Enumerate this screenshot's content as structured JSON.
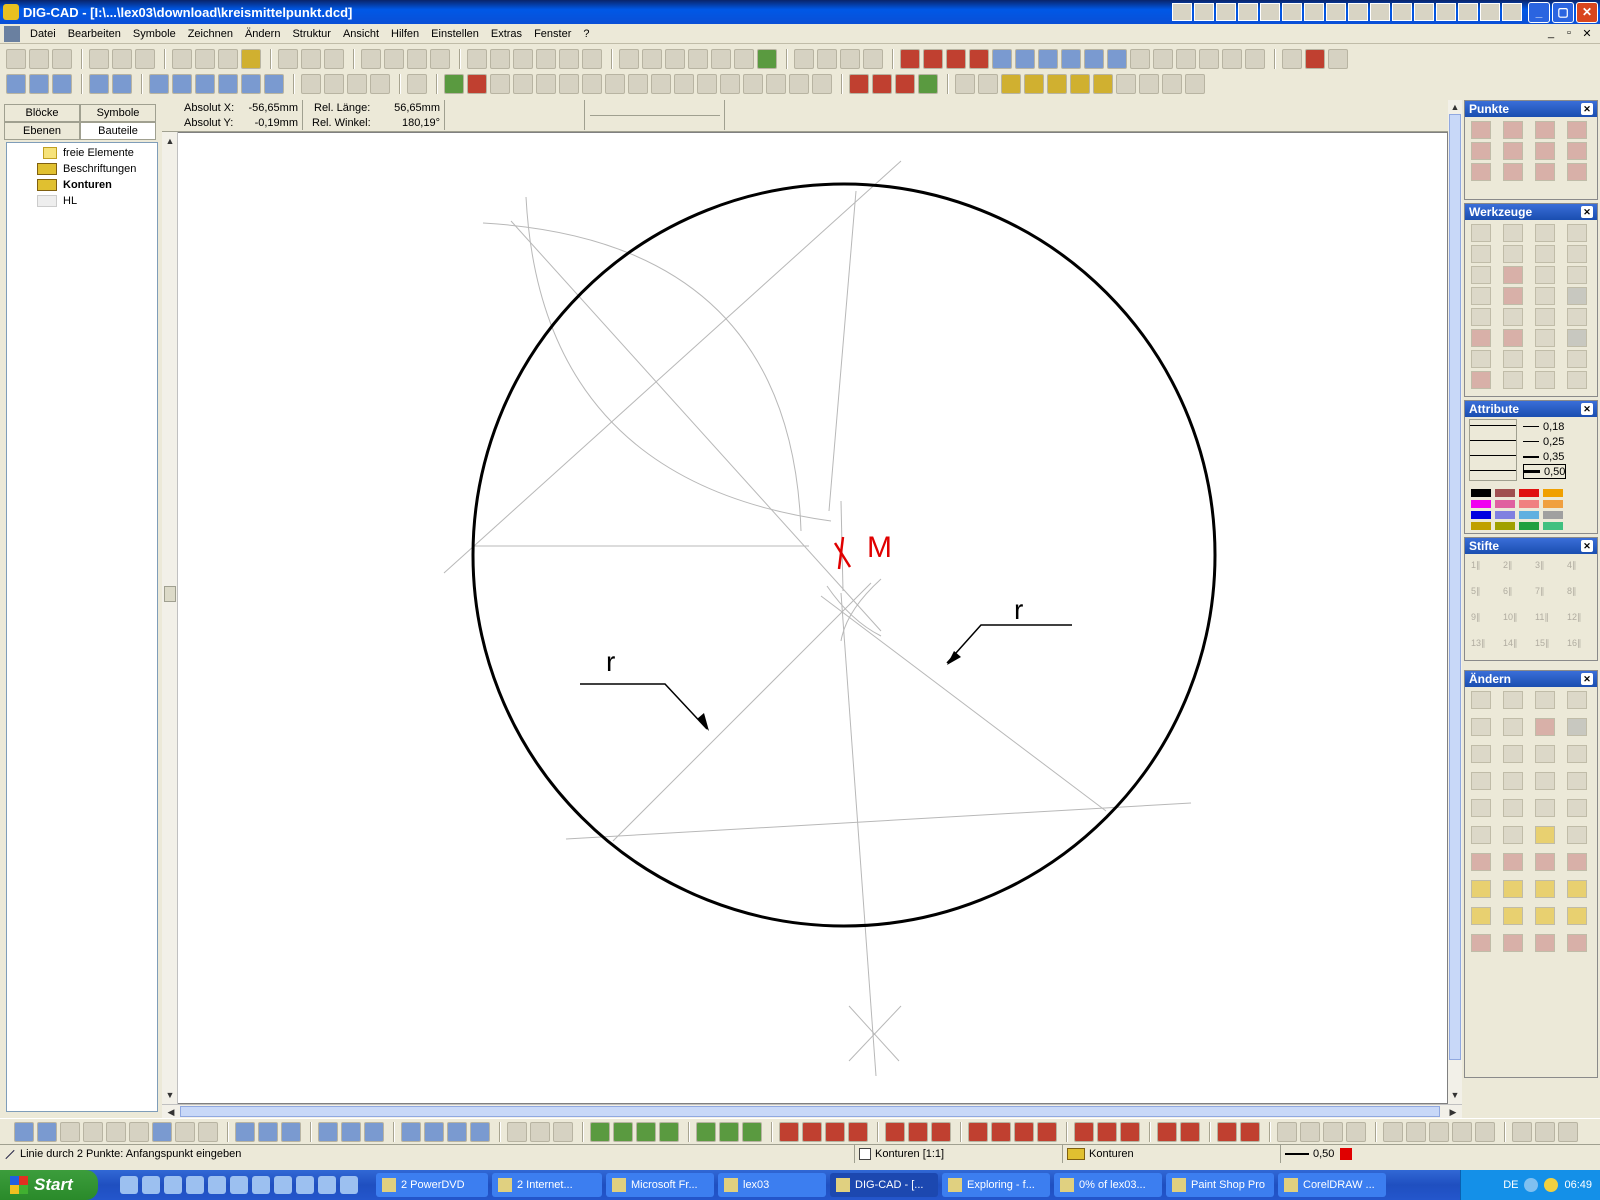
{
  "window": {
    "title": "DIG-CAD - [I:\\...\\lex03\\download\\kreismittelpunkt.dcd]"
  },
  "menu": [
    "Datei",
    "Bearbeiten",
    "Symbole",
    "Zeichnen",
    "Ändern",
    "Struktur",
    "Ansicht",
    "Hilfen",
    "Einstellen",
    "Extras",
    "Fenster",
    "?"
  ],
  "left": {
    "tabs": [
      "Blöcke",
      "Symbole",
      "Ebenen",
      "Bauteile"
    ],
    "tree": [
      "freie Elemente",
      "Beschriftungen",
      "Konturen",
      "HL"
    ]
  },
  "coords": {
    "absx_label": "Absolut X:",
    "absx_value": "-56,65mm",
    "absy_label": "Absolut Y:",
    "absy_value": "-0,19mm",
    "rel_len_label": "Rel. Länge:",
    "rel_len_value": "56,65mm",
    "rel_angle_label": "Rel. Winkel:",
    "rel_angle_value": "180,19°"
  },
  "drawing": {
    "center_label": "M",
    "radius_label_1": "r",
    "radius_label_2": "r"
  },
  "palettes": {
    "punkte": "Punkte",
    "werkzeuge": "Werkzeuge",
    "attribute": "Attribute",
    "line_widths": [
      "0,18",
      "0,25",
      "0,35",
      "0,50"
    ],
    "stifte": "Stifte",
    "aendern": "Ändern",
    "swatch_colors": [
      "#000000",
      "#a05050",
      "#e01010",
      "#f0a000",
      "#f000f0",
      "#e060a0",
      "#f08080",
      "#f0a040",
      "#0000e0",
      "#8080e0",
      "#60b0e0",
      "#a0a0a0",
      "#c0a000",
      "#a0a000",
      "#20a040",
      "#40c080"
    ]
  },
  "status": {
    "hint": "Linie durch 2 Punkte: Anfangspunkt eingeben",
    "layer": "Konturen [1:1]",
    "group": "Konturen",
    "width": "0,50"
  },
  "taskbar": {
    "start": "Start",
    "items": [
      "2 PowerDVD",
      "2 Internet...",
      "Microsoft Fr...",
      "lex03",
      "DIG-CAD - [...",
      "Exploring - f...",
      "0% of lex03...",
      "Paint Shop Pro",
      "CorelDRAW ..."
    ],
    "lang": "DE",
    "clock": "06:49"
  }
}
